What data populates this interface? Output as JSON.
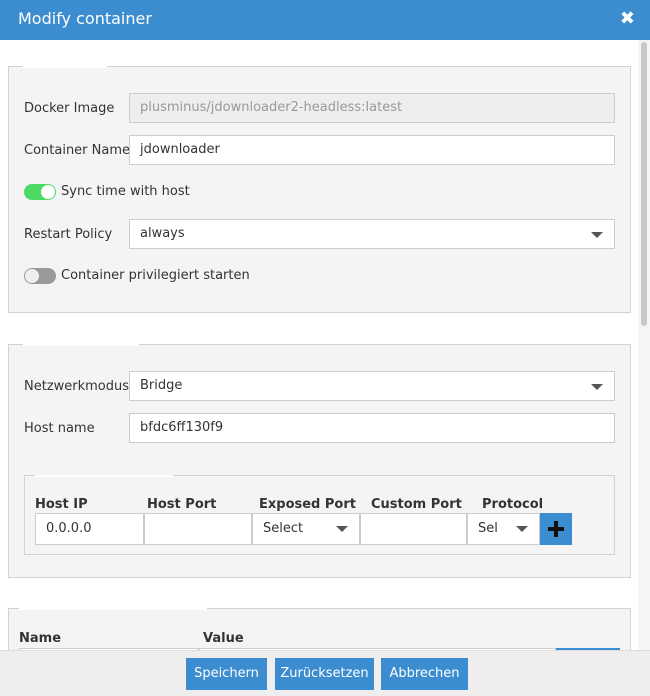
{
  "dialog": {
    "title": "Modify container",
    "close_glyph": "✖"
  },
  "general": {
    "docker_image_label": "Docker Image",
    "docker_image_value": "plusminus/jdownloader2-headless:latest",
    "container_name_label": "Container Name",
    "container_name_value": "jdownloader",
    "sync_time_label": "Sync time with host",
    "sync_time_on": true,
    "restart_policy_label": "Restart Policy",
    "restart_policy_value": "always",
    "privileged_label": "Container privilegiert starten",
    "privileged_on": false
  },
  "network": {
    "mode_label": "Netzwerkmodus",
    "mode_value": "Bridge",
    "hostname_label": "Host name",
    "hostname_value": "bfdc6ff130f9",
    "ports": {
      "headers": [
        "Host IP",
        "Host Port",
        "Exposed Port",
        "Custom Port",
        "Protocol"
      ],
      "host_ip": "0.0.0.0",
      "host_port": "",
      "exposed_port": "Select",
      "custom_port": "",
      "protocol": "Sel"
    }
  },
  "env": {
    "headers": [
      "Name",
      "Value"
    ]
  },
  "footer": {
    "save": "Speichern",
    "reset": "Zurücksetzen",
    "cancel": "Abbrechen"
  },
  "colors": {
    "accent": "#3c8dd0",
    "toggle_on": "#4cd964"
  }
}
